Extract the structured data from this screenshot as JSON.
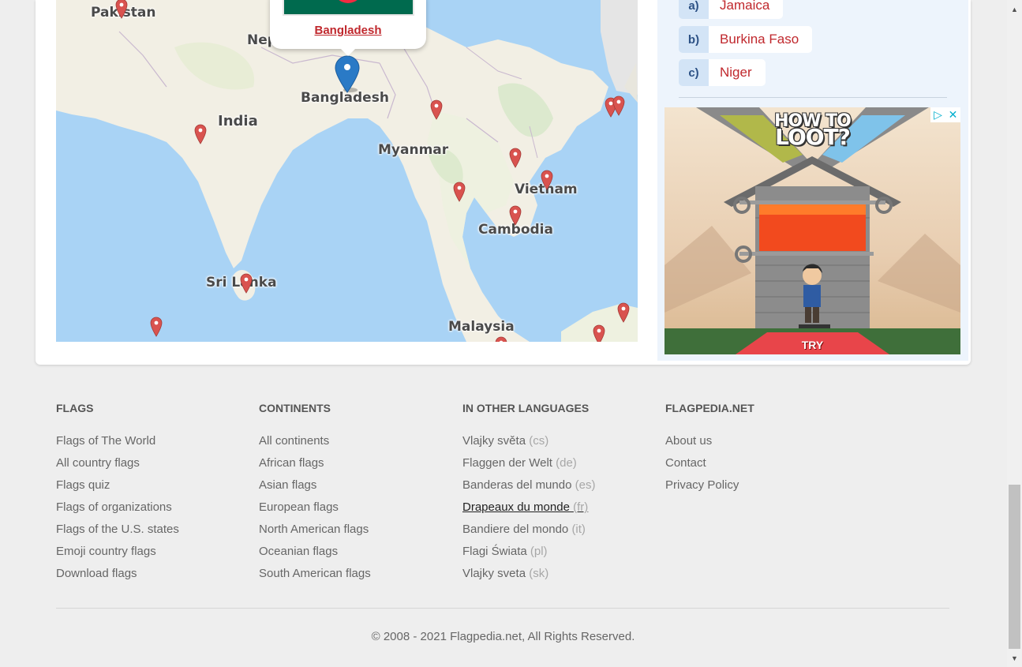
{
  "map": {
    "labels": {
      "pakistan": "Pakistan",
      "nepal": "Nep",
      "bangladesh": "Bangladesh",
      "india": "India",
      "myanmar": "Myanmar",
      "vietnam": "Vietnam",
      "cambodia": "Cambodia",
      "sri_lanka": "Sri Lanka",
      "malaysia": "Malaysia"
    },
    "popup": {
      "country_link": "Bangladesh",
      "flag_colors": {
        "field": "#006a4e",
        "disc": "#f42a41"
      }
    },
    "selected_pin_color": "#2a7ac6",
    "pin_color": "#d9534f"
  },
  "quiz": {
    "answers": [
      {
        "letter": "a)",
        "text": "Jamaica"
      },
      {
        "letter": "b)",
        "text": "Burkina Faso"
      },
      {
        "letter": "c)",
        "text": "Niger"
      }
    ]
  },
  "ad": {
    "title_line1": "HOW TO",
    "title_line2": "LOOT?",
    "cta": "TRY",
    "adchoices_icon": "adchoices-icon",
    "close_icon": "close-icon"
  },
  "footer": {
    "columns": [
      {
        "heading": "FLAGS",
        "links": [
          {
            "label": "Flags of The World"
          },
          {
            "label": "All country flags"
          },
          {
            "label": "Flags quiz"
          },
          {
            "label": "Flags of organizations"
          },
          {
            "label": "Flags of the U.S. states"
          },
          {
            "label": "Emoji country flags"
          },
          {
            "label": "Download flags"
          }
        ]
      },
      {
        "heading": "CONTINENTS",
        "links": [
          {
            "label": "All continents"
          },
          {
            "label": "African flags"
          },
          {
            "label": "Asian flags"
          },
          {
            "label": "European flags"
          },
          {
            "label": "North American flags"
          },
          {
            "label": "Oceanian flags"
          },
          {
            "label": "South American flags"
          }
        ]
      },
      {
        "heading": "IN OTHER LANGUAGES",
        "links": [
          {
            "label": "Vlajky světa",
            "code": "(cs)"
          },
          {
            "label": "Flaggen der Welt",
            "code": "(de)"
          },
          {
            "label": "Banderas del mundo",
            "code": "(es)"
          },
          {
            "label": "Drapeaux du monde",
            "code": "(fr)"
          },
          {
            "label": "Bandiere del mondo",
            "code": "(it)"
          },
          {
            "label": "Flagi Świata",
            "code": "(pl)"
          },
          {
            "label": "Vlajky sveta",
            "code": "(sk)"
          }
        ]
      },
      {
        "heading": "FLAGPEDIA.NET",
        "links": [
          {
            "label": "About us"
          },
          {
            "label": "Contact"
          },
          {
            "label": "Privacy Policy"
          }
        ]
      }
    ],
    "copyright": "© 2008 - 2021 Flagpedia.net, All Rights Reserved."
  }
}
